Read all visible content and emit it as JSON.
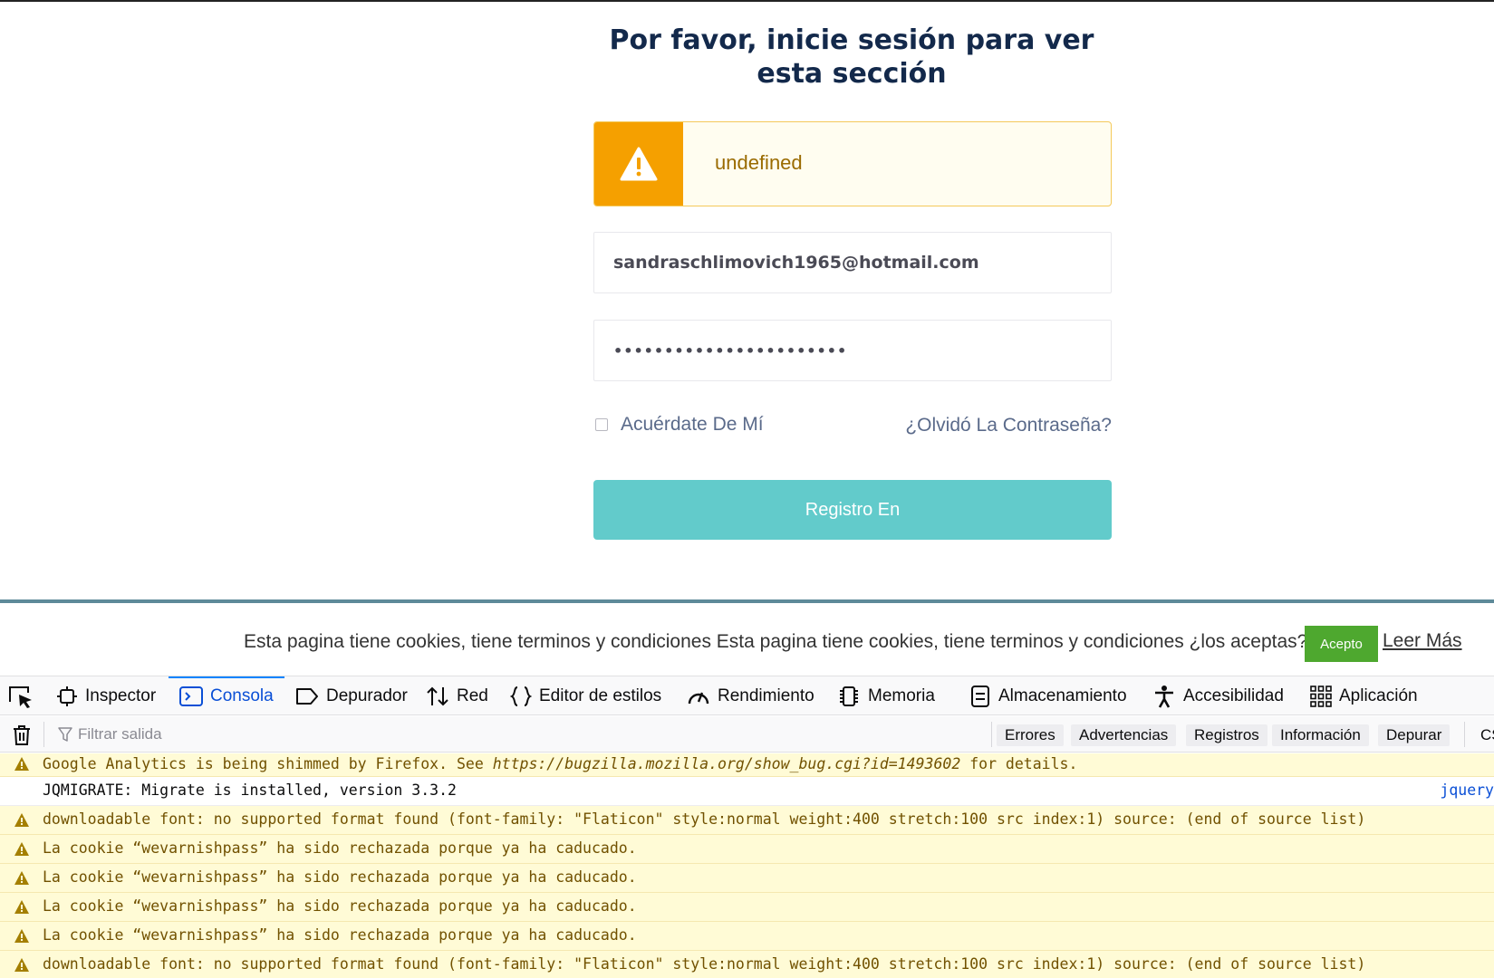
{
  "login": {
    "title": "Por favor, inicie sesión para ver esta sección",
    "alert_text": "undefined",
    "email_value": "sandraschlimovich1965@hotmail.com",
    "password_value": "•••••••••••••••••••••••",
    "remember_label": "Acuérdate De Mí",
    "forgot_label": "¿Olvidó La Contraseña?",
    "submit_label": "Registro En"
  },
  "cookie_bar": {
    "text": "Esta pagina tiene cookies, tiene terminos y condiciones Esta pagina tiene cookies, tiene terminos y condiciones ¿los aceptas?",
    "accept_label": "Acepto",
    "more_label": "Leer Más"
  },
  "devtools": {
    "tabs": [
      {
        "label": "Inspector",
        "icon": "inspector-icon"
      },
      {
        "label": "Consola",
        "icon": "console-icon",
        "active": true
      },
      {
        "label": "Depurador",
        "icon": "debugger-icon"
      },
      {
        "label": "Red",
        "icon": "network-icon"
      },
      {
        "label": "Editor de estilos",
        "icon": "style-editor-icon"
      },
      {
        "label": "Rendimiento",
        "icon": "performance-icon"
      },
      {
        "label": "Memoria",
        "icon": "memory-icon"
      },
      {
        "label": "Almacenamiento",
        "icon": "storage-icon"
      },
      {
        "label": "Accesibilidad",
        "icon": "accessibility-icon"
      },
      {
        "label": "Aplicación",
        "icon": "application-icon"
      }
    ],
    "filter_placeholder": "Filtrar salida",
    "levels": [
      "Errores",
      "Advertencias",
      "Registros",
      "Información",
      "Depurar"
    ],
    "css_label": "CS",
    "messages": [
      {
        "type": "warn",
        "text_before": "Google Analytics is being shimmed by Firefox. See ",
        "link": "https://bugzilla.mozilla.org/show_bug.cgi?id=1493602",
        "text_after": " for details."
      },
      {
        "type": "log",
        "text": "JQMIGRATE: Migrate is installed, version 3.3.2",
        "source": "jquery"
      },
      {
        "type": "warn",
        "text": "downloadable font: no supported format found (font-family: \"Flaticon\" style:normal weight:400 stretch:100 src index:1) source: (end of source list)"
      },
      {
        "type": "warn",
        "text": "La cookie “wevarnishpass” ha sido rechazada porque ya ha caducado."
      },
      {
        "type": "warn",
        "text": "La cookie “wevarnishpass” ha sido rechazada porque ya ha caducado."
      },
      {
        "type": "warn",
        "text": "La cookie “wevarnishpass” ha sido rechazada porque ya ha caducado."
      },
      {
        "type": "warn",
        "text": "La cookie “wevarnishpass” ha sido rechazada porque ya ha caducado."
      },
      {
        "type": "warn",
        "text": "downloadable font: no supported format found (font-family: \"Flaticon\" style:normal weight:400 stretch:100 src index:1) source: (end of source list)"
      }
    ]
  },
  "colors": {
    "title": "#13294b",
    "alert_accent": "#f5a000",
    "submit_button": "#62cbcb",
    "accept_button": "#4ea82f",
    "active_tab": "#0a84ff",
    "warning_background": "#fffbd6"
  }
}
